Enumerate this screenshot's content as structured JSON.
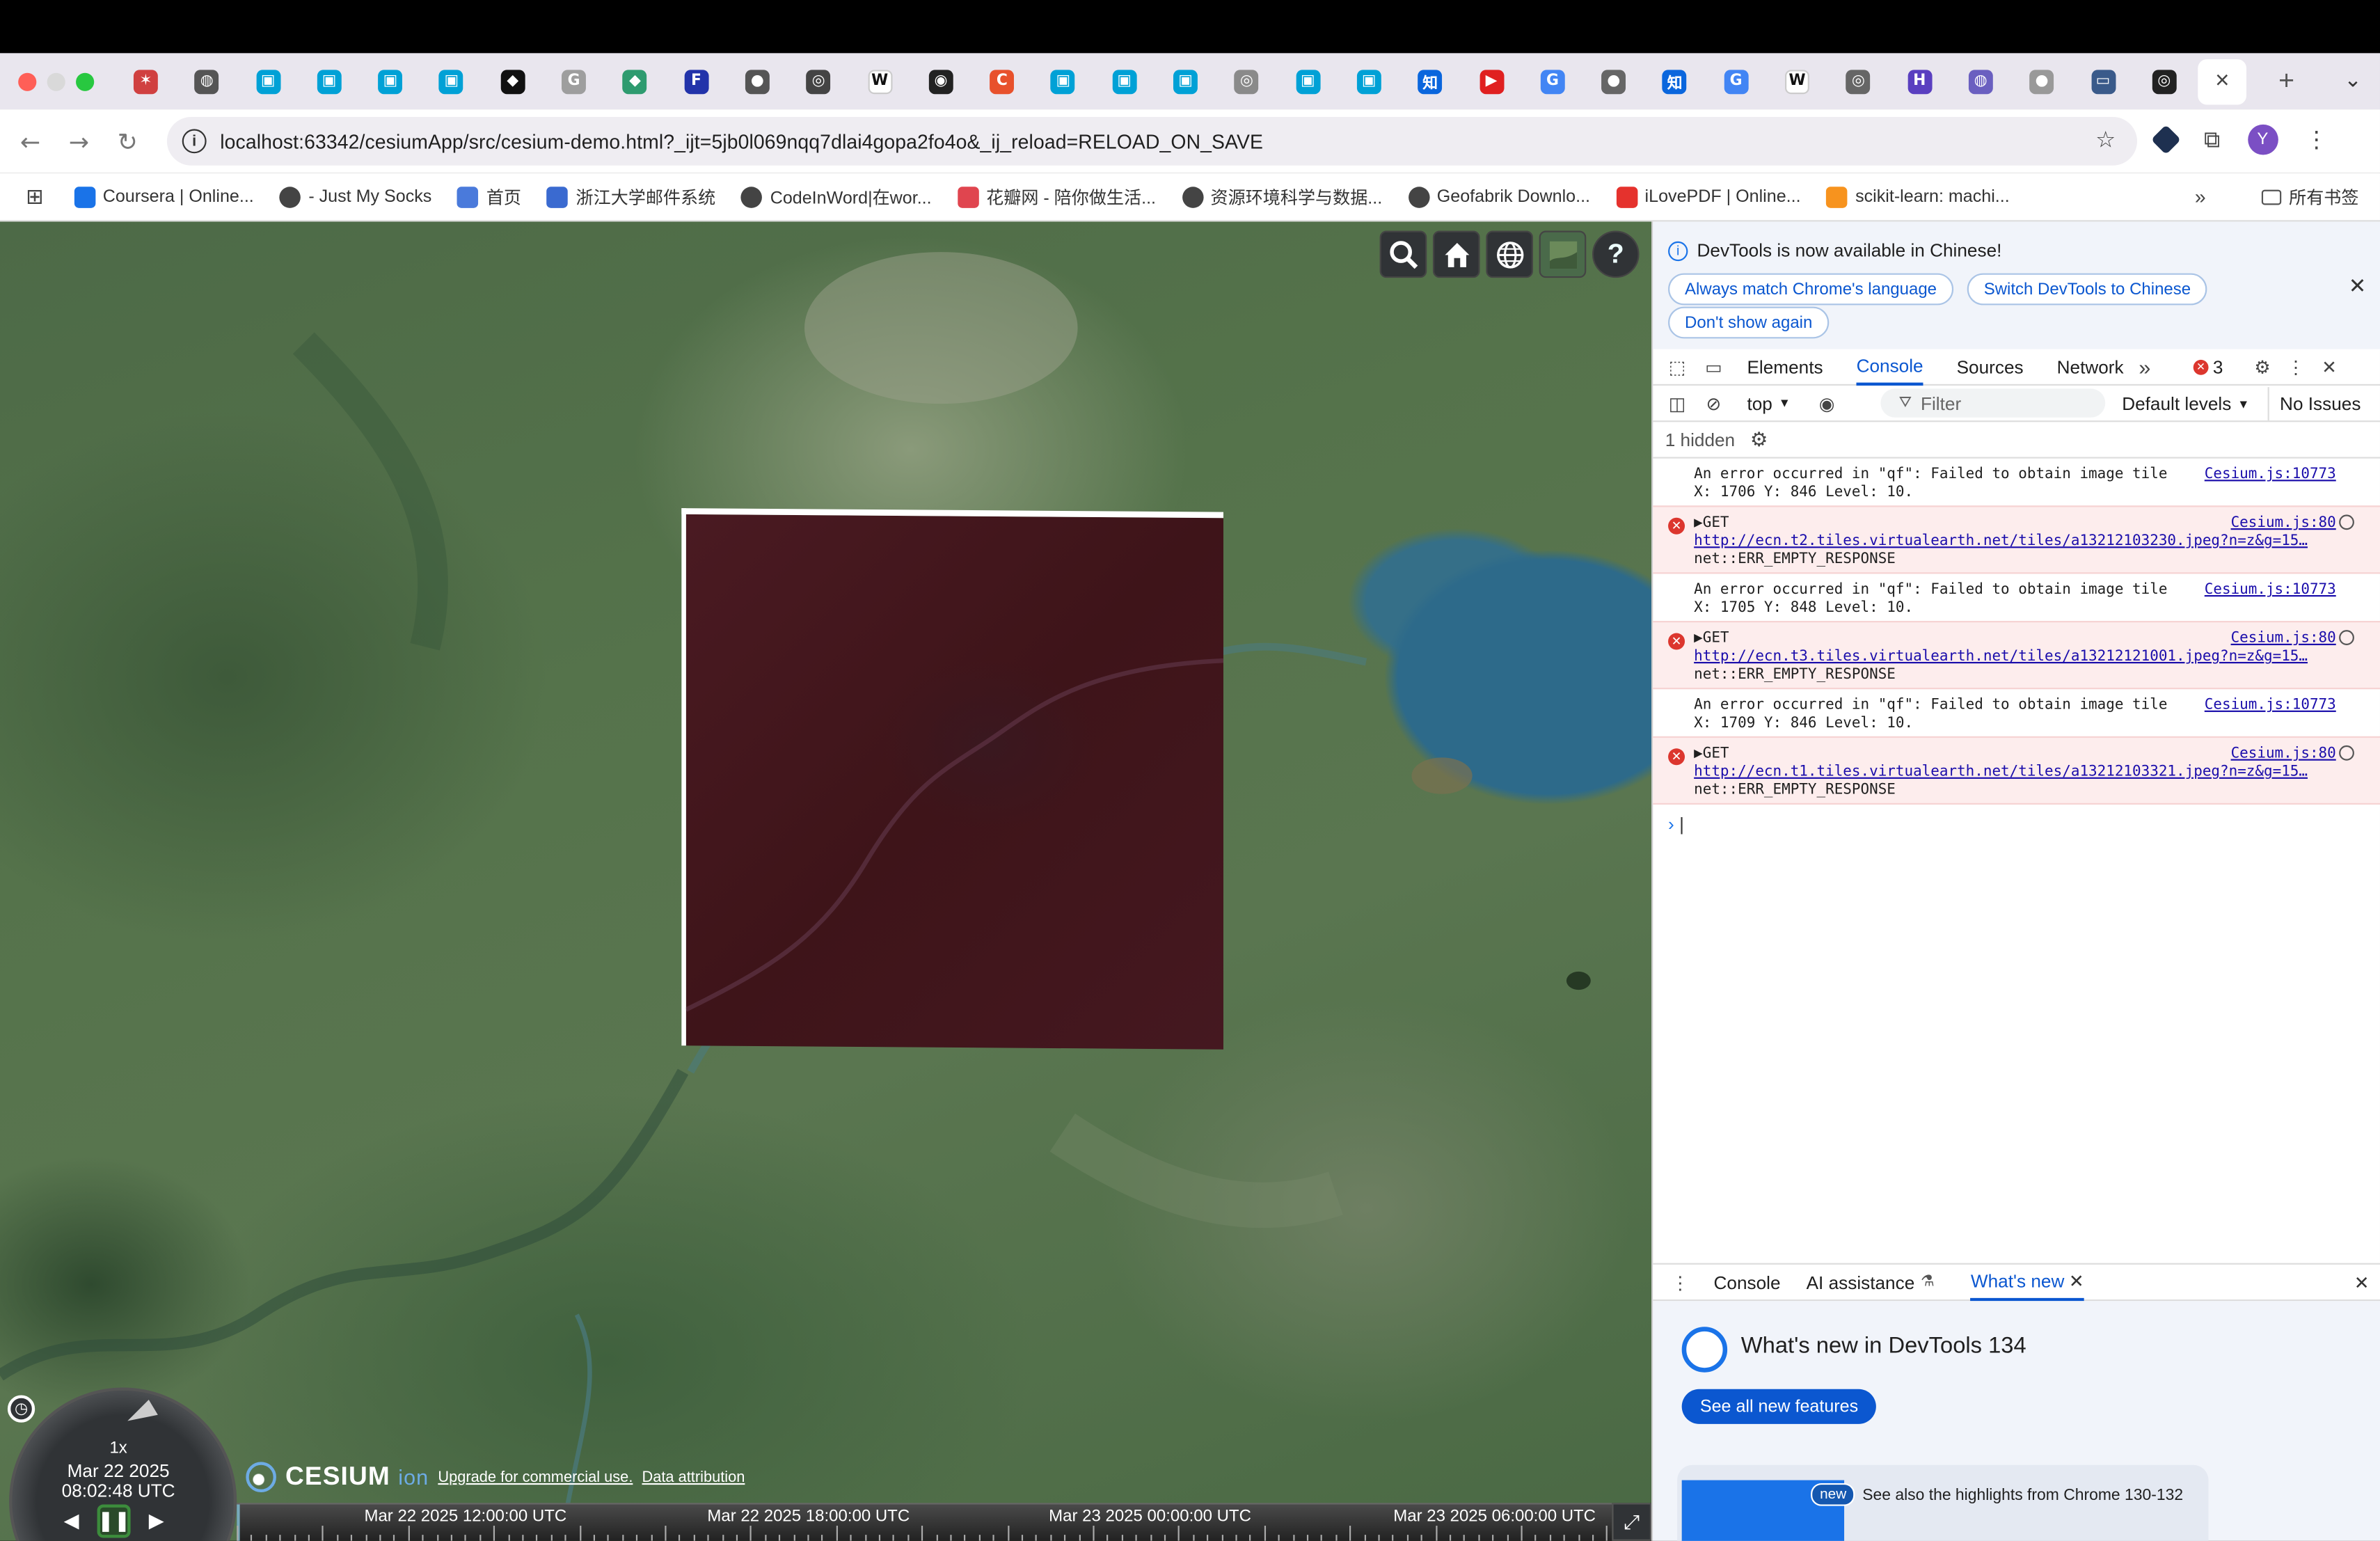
{
  "browser": {
    "tabs": [
      {
        "icon": "colorful-pinwheel-icon",
        "color": "#d04040",
        "glyph": "✶"
      },
      {
        "icon": "robot-icon",
        "color": "#555555",
        "glyph": "◍"
      },
      {
        "icon": "bilibili-icon",
        "color": "#00a1d6",
        "glyph": "▣"
      },
      {
        "icon": "bilibili-icon",
        "color": "#00a1d6",
        "glyph": "▣"
      },
      {
        "icon": "bilibili-icon",
        "color": "#00a1d6",
        "glyph": "▣"
      },
      {
        "icon": "bilibili-icon",
        "color": "#00a1d6",
        "glyph": "▣"
      },
      {
        "icon": "black-square-icon",
        "color": "#111111",
        "glyph": "◆"
      },
      {
        "icon": "gray-circle-g-icon",
        "color": "#9e9e9e",
        "glyph": "G"
      },
      {
        "icon": "green-diamond-icon",
        "color": "#2e9b6f",
        "glyph": "◆"
      },
      {
        "icon": "blue-red-app-icon",
        "color": "#2233aa",
        "glyph": "F"
      },
      {
        "icon": "globe-icon",
        "color": "#555555",
        "glyph": "●"
      },
      {
        "icon": "openai-icon",
        "color": "#444444",
        "glyph": "◎"
      },
      {
        "icon": "wikipedia-icon",
        "color": "#ffffff",
        "glyph": "W"
      },
      {
        "icon": "github-icon",
        "color": "#222222",
        "glyph": "◉"
      },
      {
        "icon": "red-c-icon",
        "color": "#e8512c",
        "glyph": "C"
      },
      {
        "icon": "bilibili-icon",
        "color": "#00a1d6",
        "glyph": "▣"
      },
      {
        "icon": "bilibili-icon",
        "color": "#00a1d6",
        "glyph": "▣"
      },
      {
        "icon": "bilibili-icon",
        "color": "#00a1d6",
        "glyph": "▣"
      },
      {
        "icon": "openai-icon",
        "color": "#8a8a8a",
        "glyph": "◎"
      },
      {
        "icon": "bilibili-icon",
        "color": "#00a1d6",
        "glyph": "▣"
      },
      {
        "icon": "bilibili-icon",
        "color": "#00a1d6",
        "glyph": "▣"
      },
      {
        "icon": "zhihu-icon",
        "color": "#0a66dd",
        "glyph": "知"
      },
      {
        "icon": "youtube-icon",
        "color": "#e02020",
        "glyph": "▶"
      },
      {
        "icon": "google-icon",
        "color": "#4285f4",
        "glyph": "G"
      },
      {
        "icon": "globe-icon",
        "color": "#666666",
        "glyph": "●"
      },
      {
        "icon": "zhihu-icon",
        "color": "#0a66dd",
        "glyph": "知"
      },
      {
        "icon": "google-icon",
        "color": "#4285f4",
        "glyph": "G"
      },
      {
        "icon": "wikipedia-icon",
        "color": "#ffffff",
        "glyph": "W"
      },
      {
        "icon": "openai-icon",
        "color": "#666666",
        "glyph": "◎"
      },
      {
        "icon": "purple-h-icon",
        "color": "#5a3fc0",
        "glyph": "H"
      },
      {
        "icon": "purple-globe-icon",
        "color": "#6a5fc0",
        "glyph": "◍"
      },
      {
        "icon": "globe-icon",
        "color": "#999999",
        "glyph": "●"
      },
      {
        "icon": "monitor-icon",
        "color": "#3a5a8a",
        "glyph": "▭"
      },
      {
        "icon": "dark-circle-icon",
        "color": "#222222",
        "glyph": "◎"
      }
    ],
    "active_tab_close": "×",
    "new_tab": "+",
    "tab_menu": "⌄",
    "address": "localhost:63342/cesiumApp/src/cesium-demo.html?_ijt=5jb0l069nqq7dlai4gopa2fo4o&_ij_reload=RELOAD_ON_SAVE",
    "avatar_letter": "Y",
    "bookmarks": [
      {
        "label": "Coursera | Online...",
        "icon": "coursera-icon",
        "color": "#1a73e8"
      },
      {
        "label": "- Just My Socks",
        "icon": "globe-icon",
        "color": "#444444"
      },
      {
        "label": "首页",
        "icon": "check-icon",
        "color": "#4a7adb"
      },
      {
        "label": "浙江大学邮件系统",
        "icon": "mail-icon",
        "color": "#3a6ad0"
      },
      {
        "label": "CodeInWord|在wor...",
        "icon": "globe-icon",
        "color": "#444444"
      },
      {
        "label": "花瓣网 - 陪你做生活...",
        "icon": "petal-icon",
        "color": "#e0454f"
      },
      {
        "label": "资源环境科学与数据...",
        "icon": "globe-icon",
        "color": "#444444"
      },
      {
        "label": "Geofabrik Downlo...",
        "icon": "globe-icon",
        "color": "#444444"
      },
      {
        "label": "iLovePDF | Online...",
        "icon": "heart-icon",
        "color": "#e5322d"
      },
      {
        "label": "scikit-learn: machi...",
        "icon": "chart-icon",
        "color": "#f7931e"
      }
    ],
    "bookmarks_more": "»",
    "all_bookmarks": "所有书签"
  },
  "cesium": {
    "speed": "1x",
    "date": "Mar 22 2025",
    "time": "08:02:48 UTC",
    "logo_text": "CESIUM",
    "logo_ion": "ion",
    "upgrade_link": "Upgrade for commercial use.",
    "attribution_link": "Data attribution",
    "timeline_labels": [
      "Mar 22 2025 12:00:00 UTC",
      "Mar 22 2025 18:00:00 UTC",
      "Mar 23 2025 00:00:00 UTC",
      "Mar 23 2025 06:00:00 UTC"
    ],
    "help": "?"
  },
  "devtools": {
    "notice": "DevTools is now available in Chinese!",
    "btn_match": "Always match Chrome's language",
    "btn_switch": "Switch DevTools to Chinese",
    "btn_dont": "Don't show again",
    "tabs": [
      "Elements",
      "Console",
      "Sources",
      "Network"
    ],
    "more_tabs": "»",
    "error_count": "3",
    "context": "top",
    "filter_placeholder": "Filter",
    "levels": "Default levels",
    "issues": "No Issues",
    "hidden": "1 hidden",
    "console": [
      {
        "type": "warn",
        "text": "An error occurred in \"qf\": Failed to obtain image tile\nX: 1706 Y: 846 Level: 10.",
        "src": "Cesium.js:10773"
      },
      {
        "type": "error",
        "head": "▶GET",
        "url": "http://ecn.t2.tiles.virtualearth.net/tiles/a13212103230.jpeg?n=z&g=15…",
        "tail": "net::ERR_EMPTY_RESPONSE",
        "src": "Cesium.js:80"
      },
      {
        "type": "warn",
        "text": "An error occurred in \"qf\": Failed to obtain image tile\nX: 1705 Y: 848 Level: 10.",
        "src": "Cesium.js:10773"
      },
      {
        "type": "error",
        "head": "▶GET",
        "url": "http://ecn.t3.tiles.virtualearth.net/tiles/a13212121001.jpeg?n=z&g=15…",
        "tail": "net::ERR_EMPTY_RESPONSE",
        "src": "Cesium.js:80"
      },
      {
        "type": "warn",
        "text": "An error occurred in \"qf\": Failed to obtain image tile\nX: 1709 Y: 846 Level: 10.",
        "src": "Cesium.js:10773"
      },
      {
        "type": "error",
        "head": "▶GET",
        "url": "http://ecn.t1.tiles.virtualearth.net/tiles/a13212103321.jpeg?n=z&g=15…",
        "tail": "net::ERR_EMPTY_RESPONSE",
        "src": "Cesium.js:80"
      }
    ],
    "prompt": "›",
    "drawer_tabs": [
      "Console",
      "AI assistance",
      "What's new"
    ],
    "whatsnew_title": "What's new in DevTools 134",
    "whatsnew_button": "See all new features",
    "card_badge": "new",
    "card_text": "See also the highlights from Chrome 130-132"
  }
}
